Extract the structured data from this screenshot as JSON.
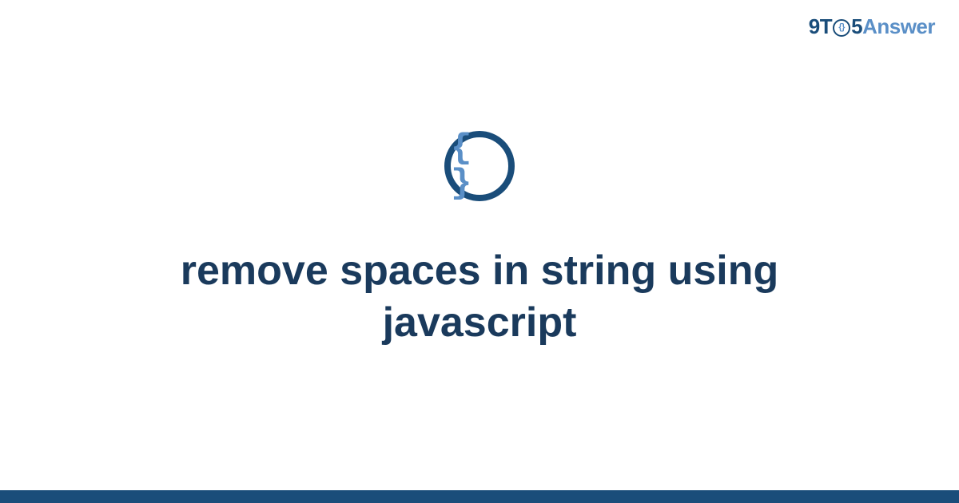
{
  "logo": {
    "part1": "9T",
    "part_o_inner": "{}",
    "part2": "5",
    "part3": "Answer"
  },
  "icon": {
    "name": "code-braces-icon",
    "glyph": "{ }"
  },
  "title": "remove spaces in string using javascript",
  "colors": {
    "dark_blue": "#1a4d7a",
    "light_blue": "#5a8fc7",
    "text": "#1a3a5c"
  }
}
